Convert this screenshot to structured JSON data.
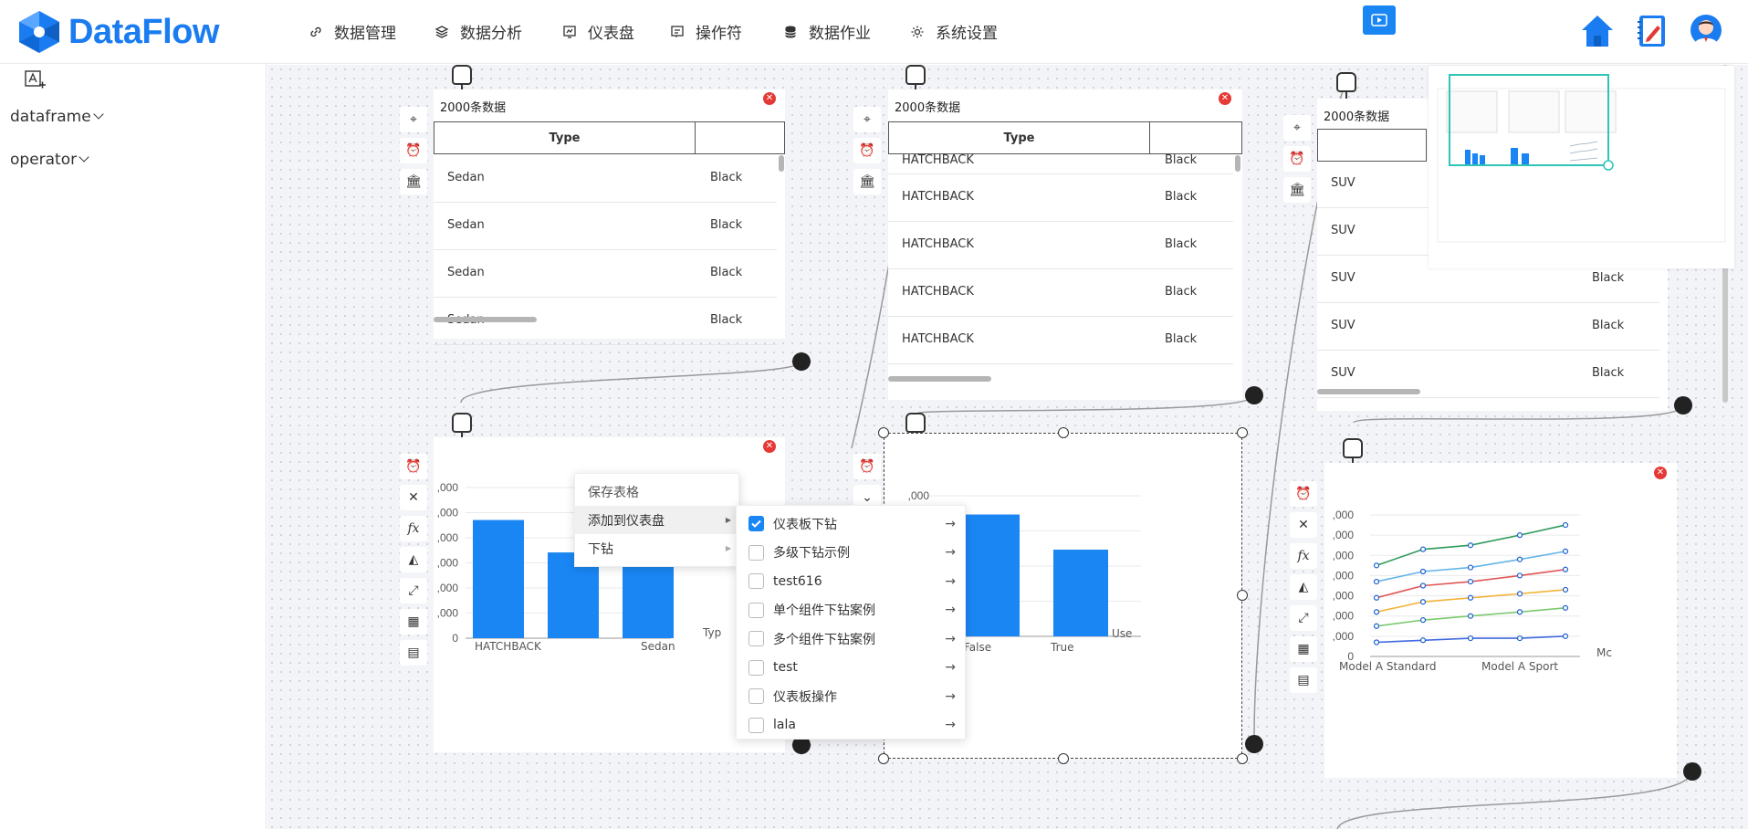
{
  "app": {
    "logo_text": "DataFlow"
  },
  "nav": [
    {
      "label": "数据管理",
      "icon": "link-icon"
    },
    {
      "label": "数据分析",
      "icon": "layers-icon"
    },
    {
      "label": "仪表盘",
      "icon": "dashboard-icon"
    },
    {
      "label": "操作符",
      "icon": "operator-icon"
    },
    {
      "label": "数据作业",
      "icon": "database-icon"
    },
    {
      "label": "系统设置",
      "icon": "gear-icon"
    }
  ],
  "sidebar": {
    "items": [
      {
        "label": "dataframe"
      },
      {
        "label": "operator"
      }
    ]
  },
  "nodes": {
    "table1": {
      "title": "2000条数据",
      "header": "Type",
      "rows": [
        [
          "Sedan",
          "Black"
        ],
        [
          "Sedan",
          "Black"
        ],
        [
          "Sedan",
          "Black"
        ],
        [
          "Sedan",
          "Black"
        ]
      ]
    },
    "table2": {
      "title": "2000条数据",
      "header": "Type",
      "partial_row": [
        "HATCHBACK",
        "Black"
      ],
      "rows": [
        [
          "HATCHBACK",
          "Black"
        ],
        [
          "HATCHBACK",
          "Black"
        ],
        [
          "HATCHBACK",
          "Black"
        ],
        [
          "HATCHBACK",
          "Black"
        ]
      ]
    },
    "table3": {
      "title": "2000条数据",
      "rows": [
        [
          "SUV",
          ""
        ],
        [
          "SUV",
          ""
        ],
        [
          "SUV",
          "Black"
        ],
        [
          "SUV",
          "Black"
        ],
        [
          "SUV",
          "Black"
        ]
      ]
    },
    "chart1": {
      "x_labels": [
        "HATCHBACK",
        "Sedan"
      ],
      "x_axis_cut": "Typ",
      "y_labels": [
        ",000",
        ",000",
        ",000",
        ",000",
        ",000",
        ",000",
        "0"
      ]
    },
    "chart2": {
      "x_labels": [
        "False",
        "True"
      ],
      "x_axis_cut": "Use",
      "y_labels": [
        ",000"
      ]
    },
    "chart3": {
      "x_labels": [
        "Model A Standard",
        "Model A Sport"
      ],
      "x_axis_cut": "Mc",
      "y_labels": [
        ",000",
        ",000",
        ",000",
        ",000",
        ",000",
        ",000",
        ",000",
        "0"
      ]
    }
  },
  "context_menu": {
    "items": [
      {
        "label": "保存表格"
      },
      {
        "label": "添加到仪表盘"
      },
      {
        "label": "下钻"
      }
    ]
  },
  "submenu": {
    "items": [
      {
        "label": "仪表板下钻",
        "checked": true
      },
      {
        "label": "多级下钻示例",
        "checked": false
      },
      {
        "label": "test616",
        "checked": false
      },
      {
        "label": "单个组件下钻案例",
        "checked": false
      },
      {
        "label": "多个组件下钻案例",
        "checked": false
      },
      {
        "label": "test",
        "checked": false
      },
      {
        "label": "仪表板操作",
        "checked": false
      },
      {
        "label": "lala",
        "checked": false
      }
    ]
  },
  "colors": {
    "brand": "#1a7cf0",
    "bar": "#1a86f4",
    "close": "#e53935",
    "minimap_frame": "#2ec4b6"
  },
  "chart_data": [
    {
      "type": "bar",
      "categories": [
        "HATCHBACK",
        "",
        "Sedan"
      ],
      "values": [
        5.1,
        3.7,
        3.1
      ],
      "ylabel": "",
      "xlabel": "Typ"
    },
    {
      "type": "bar",
      "categories": [
        "False",
        "True"
      ],
      "values": [
        5.2,
        3.7
      ],
      "xlabel": "Use"
    },
    {
      "type": "line",
      "categories": [
        "Model A Standard",
        "",
        "",
        "Model A Sport",
        ""
      ],
      "series": [
        {
          "values": [
            4.5,
            5.3,
            5.5,
            6.0,
            6.5
          ]
        },
        {
          "values": [
            3.7,
            4.2,
            4.4,
            4.8,
            5.2
          ]
        },
        {
          "values": [
            2.9,
            3.5,
            3.7,
            4.0,
            4.3
          ]
        },
        {
          "values": [
            2.2,
            2.7,
            2.9,
            3.1,
            3.3
          ]
        },
        {
          "values": [
            1.5,
            1.8,
            2.0,
            2.2,
            2.4
          ]
        },
        {
          "values": [
            0.7,
            0.8,
            0.9,
            0.9,
            1.0
          ]
        }
      ]
    }
  ]
}
